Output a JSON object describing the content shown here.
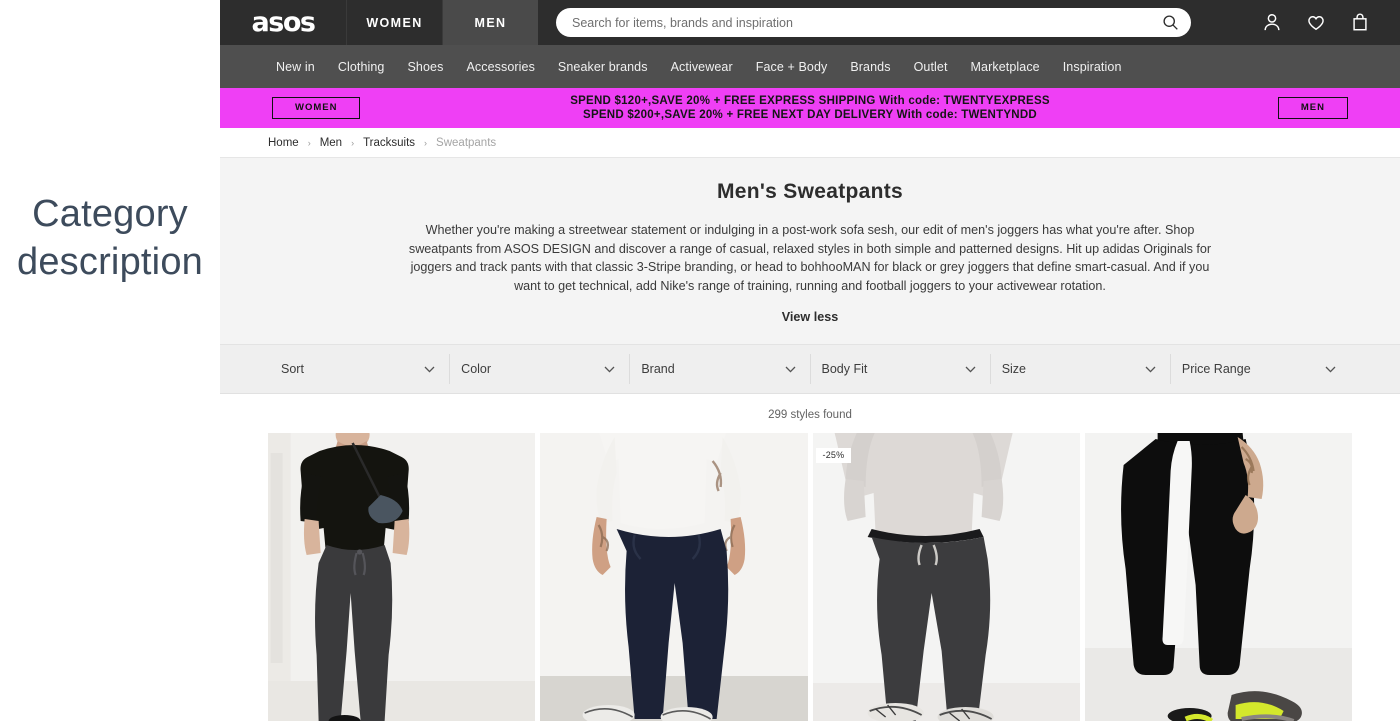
{
  "annotation": {
    "line1": "Category",
    "line2": "description",
    "arrow_icon": "right-arrow-icon"
  },
  "header": {
    "logo": "asos",
    "tabs": [
      {
        "label": "WOMEN",
        "active": false
      },
      {
        "label": "MEN",
        "active": true
      }
    ],
    "search": {
      "placeholder": "Search for items, brands and inspiration",
      "value": "",
      "icon": "search-icon"
    },
    "icons": [
      {
        "name": "account-icon"
      },
      {
        "name": "heart-icon"
      },
      {
        "name": "bag-icon"
      }
    ]
  },
  "subnav": {
    "items": [
      "New in",
      "Clothing",
      "Shoes",
      "Accessories",
      "Sneaker brands",
      "Activewear",
      "Face + Body",
      "Brands",
      "Outlet",
      "Marketplace",
      "Inspiration"
    ]
  },
  "promo": {
    "background": "#ef3ff5",
    "left_button": "WOMEN",
    "right_button": "MEN",
    "line1": "SPEND $120+,SAVE 20% + FREE EXPRESS SHIPPING With code: TWENTYEXPRESS",
    "line2": "SPEND $200+,SAVE 20% + FREE NEXT DAY DELIVERY With code: TWENTYNDD"
  },
  "breadcrumb": {
    "items": [
      "Home",
      "Men",
      "Tracksuits"
    ],
    "current": "Sweatpants",
    "separator": "›"
  },
  "description": {
    "title": "Men's Sweatpants",
    "body": "Whether you're making a streetwear statement or indulging in a post-work sofa sesh, our edit of men's joggers has what you're after. Shop sweatpants from ASOS DESIGN and discover a range of casual, relaxed styles in both simple and patterned designs. Hit up adidas Originals for joggers and track pants with that classic 3-Stripe branding, or head to bohhooMAN for black or grey joggers that define smart-casual. And if you want to get technical, add Nike's range of training, running and football joggers to your activewear rotation.",
    "toggle": "View less"
  },
  "filters": [
    {
      "label": "Sort",
      "icon": "chevron-down-icon"
    },
    {
      "label": "Color",
      "icon": "chevron-down-icon"
    },
    {
      "label": "Brand",
      "icon": "chevron-down-icon"
    },
    {
      "label": "Body Fit",
      "icon": "chevron-down-icon"
    },
    {
      "label": "Size",
      "icon": "chevron-down-icon"
    },
    {
      "label": "Price Range",
      "icon": "chevron-down-icon"
    }
  ],
  "results": {
    "count_text": "299 styles found"
  },
  "products": [
    {
      "alt": "Man in black oversized t-shirt with charcoal joggers and bum bag",
      "badge": ""
    },
    {
      "alt": "Man in white t-shirt with navy joggers and white sneakers",
      "badge": ""
    },
    {
      "alt": "Man in grey sweatshirt with dark charcoal joggers",
      "badge": "-25%"
    },
    {
      "alt": "Man in black joggers with white side stripe and neon sneakers",
      "badge": ""
    }
  ],
  "colors": {
    "header_bg": "#2d2d2d",
    "subnav_bg": "#4f4f4f",
    "promo": "#ef3ff5",
    "annotation": "#3d4b5c"
  }
}
